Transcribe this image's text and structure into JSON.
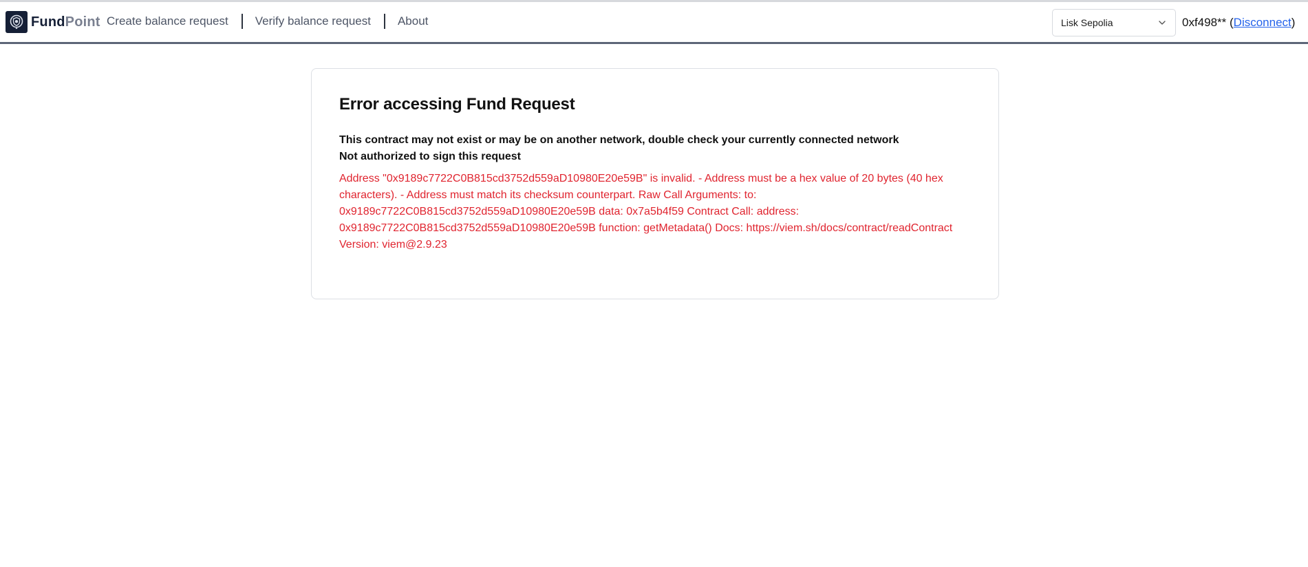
{
  "header": {
    "logo": {
      "icon": "shield-check-icon",
      "brand_part1": "Fund",
      "brand_part2": "Point"
    },
    "nav": [
      {
        "label": "Create balance request"
      },
      {
        "label": "Verify balance request"
      },
      {
        "label": "About"
      }
    ],
    "network_select": {
      "value": "Lisk Sepolia",
      "icon": "chevron-down-icon"
    },
    "account": {
      "address": "0xf498**",
      "open_paren": " (",
      "disconnect_label": "Disconnect",
      "close_paren": ")"
    }
  },
  "error_card": {
    "title": "Error accessing Fund Request",
    "messages": [
      "This contract may not exist or may be on another network, double check your currently connected network",
      "Not authorized to sign this request"
    ],
    "detail": "Address \"0x9189c7722C0B815cd3752d559aD10980E20e59B\" is invalid. - Address must be a hex value of 20 bytes (40 hex characters). - Address must match its checksum counterpart. Raw Call Arguments: to: 0x9189c7722C0B815cd3752d559aD10980E20e59B data: 0x7a5b4f59 Contract Call: address: 0x9189c7722C0B815cd3752d559aD10980E20e59B function: getMetadata() Docs: https://viem.sh/docs/contract/readContract Version: viem@2.9.23"
  },
  "colors": {
    "brand_dark": "#151f36",
    "header_border": "#5d6678",
    "error_text": "#e0242f",
    "link": "#2563eb"
  }
}
